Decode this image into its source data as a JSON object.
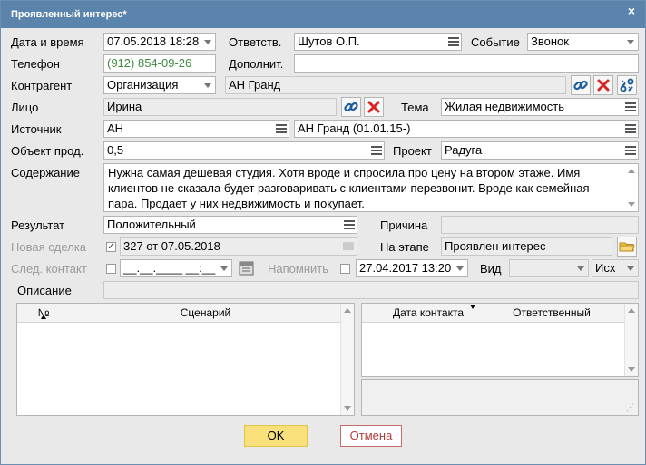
{
  "window": {
    "title": "Проявленный интерес*",
    "close_glyph": "×"
  },
  "fields": {
    "date_time": {
      "label": "Дата и время",
      "value": "07.05.2018 18:28"
    },
    "responsible": {
      "label": "Ответств.",
      "value": "Шутов О.П."
    },
    "event": {
      "label": "Событие",
      "value": "Звонок"
    },
    "phone": {
      "label": "Телефон",
      "value": "(912) 854-09-26"
    },
    "additional": {
      "label": "Дополнит.",
      "value": ""
    },
    "counterparty": {
      "label": "Контрагент",
      "type_value": "Организация",
      "value": "АН Гранд"
    },
    "person": {
      "label": "Лицо",
      "value": "Ирина"
    },
    "topic": {
      "label": "Тема",
      "value": "Жилая недвижимость"
    },
    "source": {
      "label": "Источник",
      "value": "АН",
      "value2": "АН Гранд (01.01.15-)"
    },
    "sale_object": {
      "label": "Объект прод.",
      "value": "0,5"
    },
    "project": {
      "label": "Проект",
      "value": "Радуга"
    },
    "content": {
      "label": "Содержание",
      "value": "Нужна самая дешевая студия. Хотя вроде и спросила про цену на втором этаже. Имя клиентов не сказала будет разговаривать с клиентами перезвонит. Вроде как семейная пара. Продает у них недвижимость и покупает."
    },
    "result": {
      "label": "Результат",
      "value": "Положительный"
    },
    "reason": {
      "label": "Причина",
      "value": ""
    },
    "new_deal": {
      "label": "Новая сделка",
      "checked": true,
      "check_glyph": "✓",
      "value": "327 от 07.05.2018"
    },
    "stage": {
      "label": "На этапе",
      "value": "Проявлен интерес"
    },
    "next_contact": {
      "label": "След. контакт",
      "checked": false,
      "value": "__.__.____ __:__"
    },
    "remind": {
      "label": "Напомнить",
      "checked": false,
      "value": "27.04.2017 13:20"
    },
    "kind": {
      "label": "Вид",
      "value": "",
      "direction": "Исх"
    },
    "description": {
      "label": "Описание",
      "value": ""
    }
  },
  "scenarios_table": {
    "columns": [
      "№",
      "Сценарий"
    ]
  },
  "contacts_table": {
    "columns": [
      "Дата контакта",
      "Ответственный"
    ]
  },
  "buttons": {
    "ok": "OK",
    "cancel": "Отмена"
  },
  "colors": {
    "titlebar": "#5b84ad",
    "ok_button": "#f8e07a",
    "cancel_border": "#c46b6b",
    "phone_text": "#3d8b3d"
  },
  "icons": [
    "link-icon",
    "clear-x-icon",
    "unlink-icon",
    "folder-icon",
    "calendar-icon",
    "list-menu-icon",
    "dropdown-arrow-icon"
  ]
}
